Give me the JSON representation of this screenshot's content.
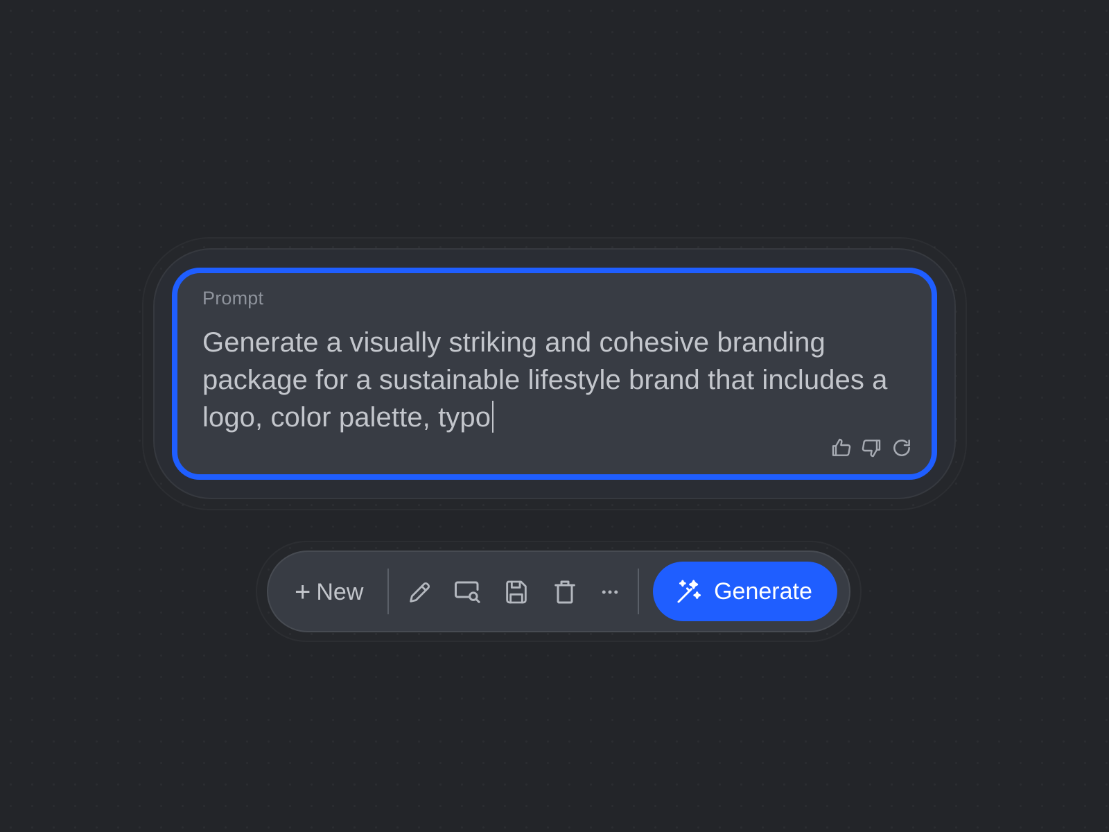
{
  "prompt": {
    "label": "Prompt",
    "text": "Generate a visually striking and cohesive branding package for a sustainable lifestyle brand that includes a logo, color palette, typo",
    "feedback_icons": [
      "thumbs-up-icon",
      "thumbs-down-icon",
      "regenerate-icon"
    ]
  },
  "toolbar": {
    "new_label": "New",
    "new_icon": "plus-icon",
    "tools": [
      "pencil-icon",
      "search-window-icon",
      "save-icon",
      "trash-icon",
      "more-icon"
    ],
    "generate_label": "Generate",
    "generate_icon": "magic-wand-icon"
  },
  "colors": {
    "background": "#232529",
    "accent": "#1f5eff",
    "surface": "#383c44",
    "text": "#c3c6cc",
    "muted_text": "#8e939c"
  }
}
